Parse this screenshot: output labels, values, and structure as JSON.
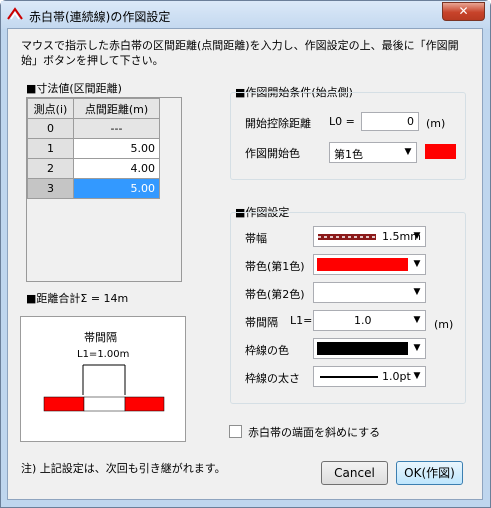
{
  "window": {
    "title": "赤白帯(連続線)の作図設定",
    "close_label": "✕"
  },
  "description": "マウスで指示した赤白帯の区間距離(点間距離)を入力し、作図設定の上、最後に「作図開始」ボタンを押して下さい。",
  "dimensions": {
    "label": "■寸法値(区間距離)",
    "columns": [
      "測点(i)",
      "点間距離(m)"
    ],
    "rows": [
      {
        "index": "0",
        "value": "---"
      },
      {
        "index": "1",
        "value": "5.00"
      },
      {
        "index": "2",
        "value": "4.00"
      },
      {
        "index": "3",
        "value": "5.00"
      }
    ]
  },
  "total_label": "■距離合計Σ = 14m",
  "preview": {
    "caption": "帯間隔",
    "dimension": "L1=1.00m"
  },
  "start_conditions": {
    "label": "■作図開始条件(始点側)",
    "offset_label": "開始控除距離",
    "offset_symbol": "L0 =",
    "offset_value": "0",
    "unit": "(m)",
    "color_label": "作図開始色",
    "color_value": "第1色",
    "color_swatch": "#ff0000"
  },
  "drawing": {
    "label": "■作図設定",
    "width_label": "帯幅",
    "width_value": "1.5mm",
    "color1_label": "帯色(第1色)",
    "color1_swatch": "#ff0000",
    "color2_label": "帯色(第2色)",
    "color2_swatch": "#ffffff",
    "interval_label": "帯間隔",
    "interval_symbol": "L1=",
    "interval_value": "1.0",
    "unit": "(m)",
    "border_color_label": "枠線の色",
    "border_color_swatch": "#000000",
    "border_width_label": "枠線の太さ",
    "border_width_value": "1.0pt"
  },
  "slant_checkbox": {
    "label": "赤白帯の端面を斜めにする",
    "checked": false
  },
  "note": "注) 上記設定は、次回も引き継がれます。",
  "buttons": {
    "cancel": "Cancel",
    "ok": "OK(作図)"
  }
}
